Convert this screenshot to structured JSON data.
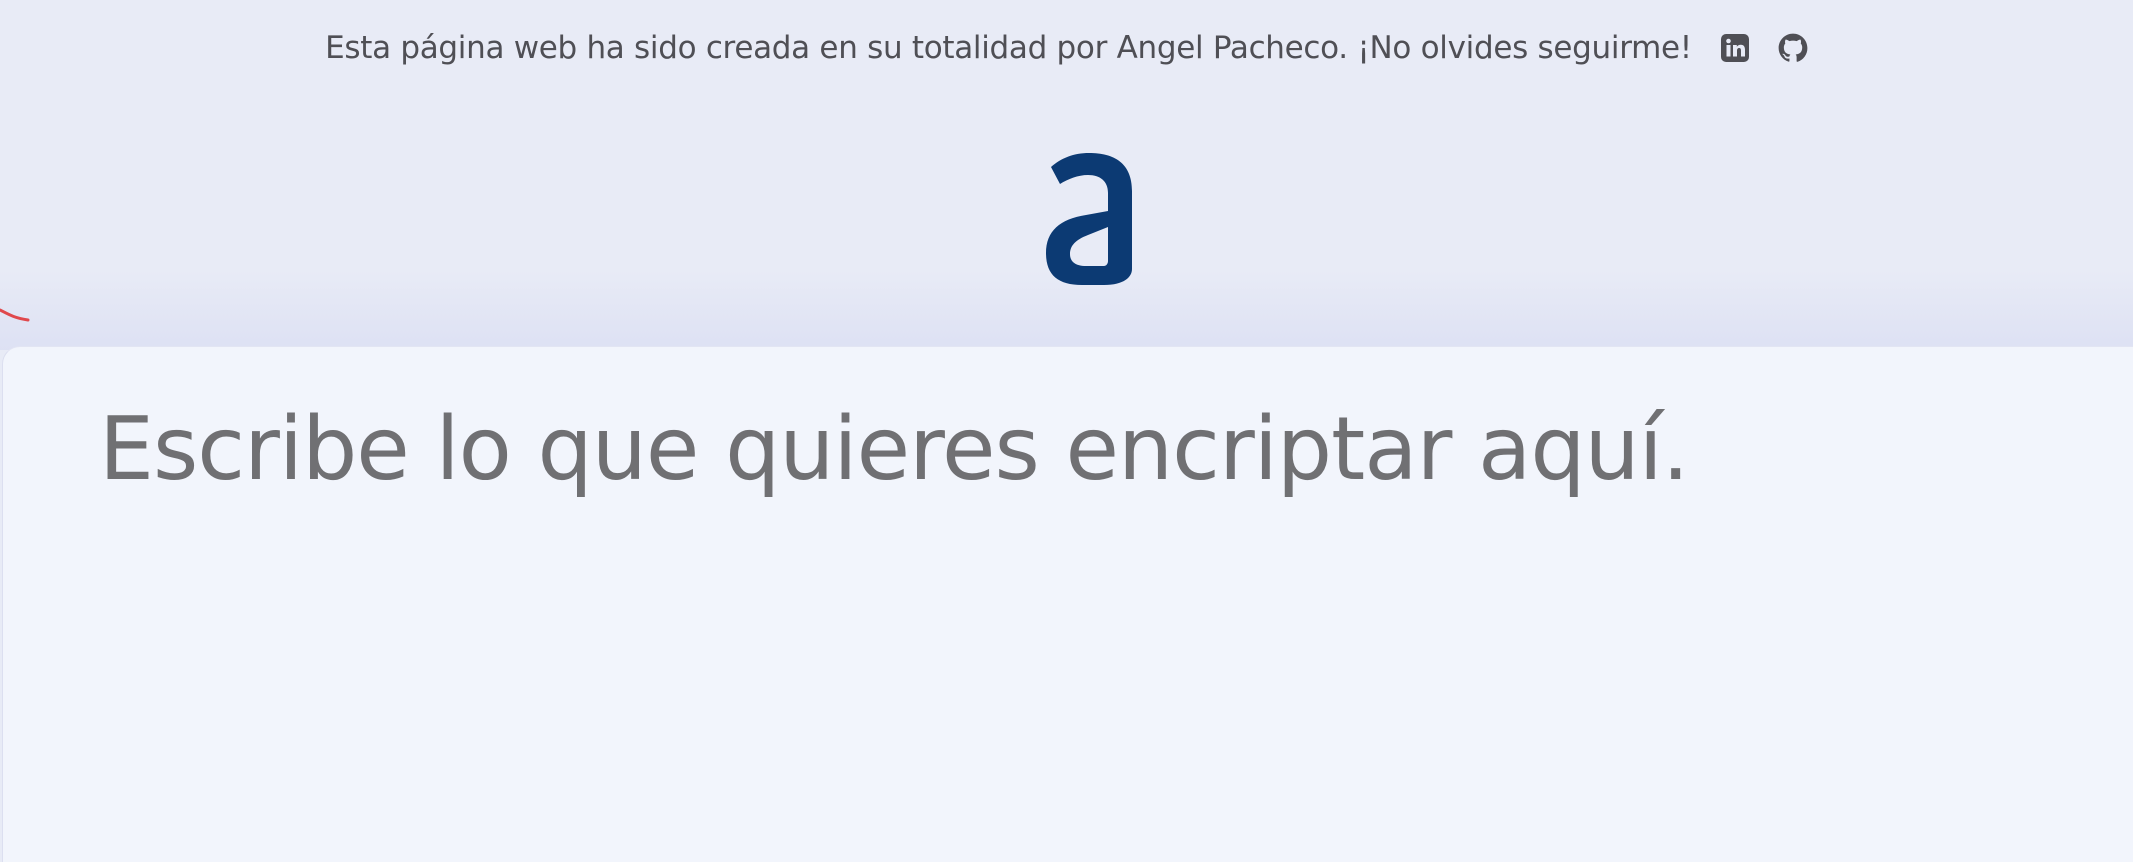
{
  "header": {
    "credit_text": "Esta página web ha sido creada en su totalidad por Angel Pacheco. ¡No olvides seguirme!",
    "social_links": [
      {
        "icon": "linkedin-icon",
        "label": "LinkedIn"
      },
      {
        "icon": "github-icon",
        "label": "GitHub"
      }
    ]
  },
  "logo": {
    "letter": "a",
    "color": "#0c3a73"
  },
  "editor": {
    "value": "",
    "placeholder": "Escribe lo que quieres encriptar aquí."
  },
  "colors": {
    "background": "#e8ebf6",
    "panel": "#f2f5fc",
    "text": "#4f4f55",
    "accent_mark": "#e0484c"
  }
}
